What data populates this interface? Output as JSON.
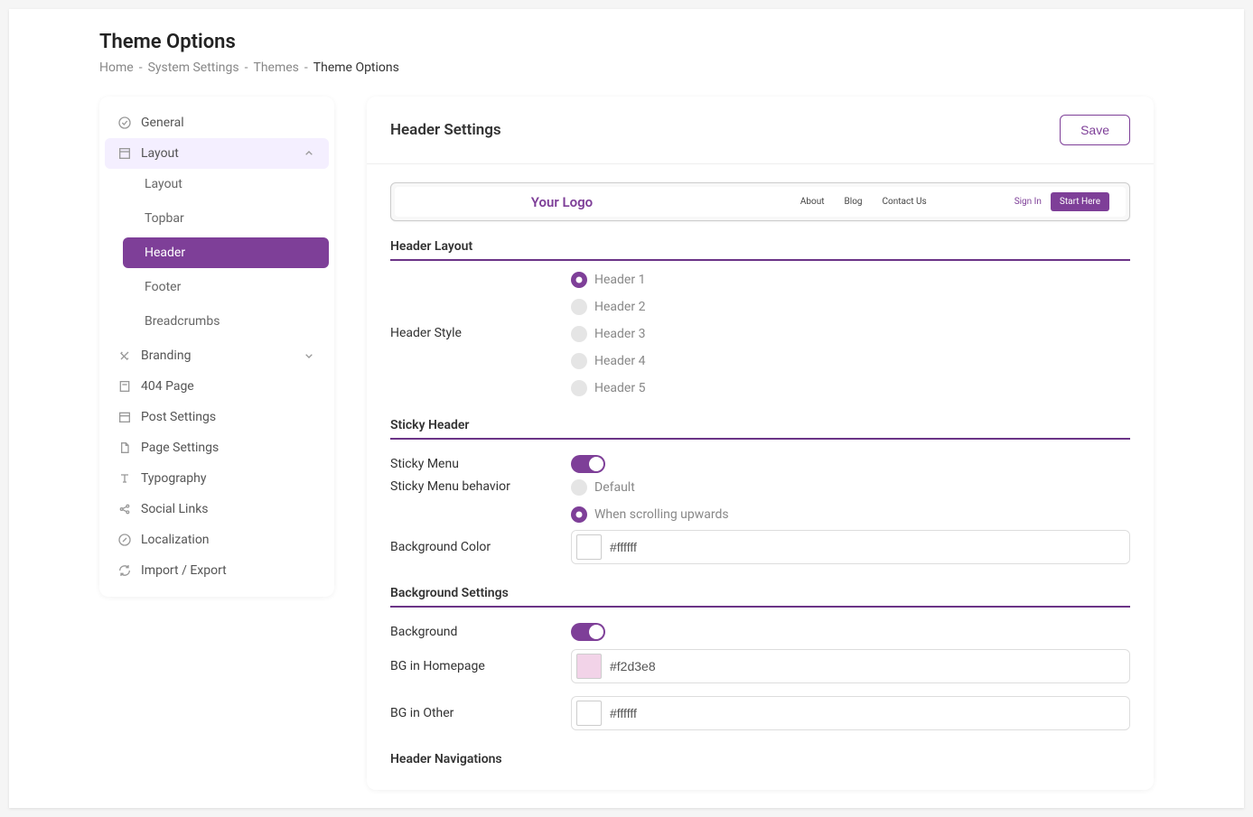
{
  "page": {
    "title": "Theme Options",
    "breadcrumb": [
      "Home",
      "System Settings",
      "Themes",
      "Theme Options"
    ]
  },
  "sidebar": {
    "general": "General",
    "layout": {
      "label": "Layout",
      "items": [
        "Layout",
        "Topbar",
        "Header",
        "Footer",
        "Breadcrumbs"
      ]
    },
    "branding": "Branding",
    "page_404": "404 Page",
    "post_settings": "Post Settings",
    "page_settings": "Page Settings",
    "typography": "Typography",
    "social_links": "Social Links",
    "localization": "Localization",
    "import_export": "Import / Export"
  },
  "main": {
    "title": "Header Settings",
    "save": "Save",
    "preview": {
      "logo": "Your Logo",
      "nav": [
        "About",
        "Blog",
        "Contact Us"
      ],
      "signin": "Sign In",
      "cta": "Start Here"
    },
    "sections": {
      "header_layout": {
        "title": "Header Layout",
        "label": "Header Style",
        "options": [
          "Header 1",
          "Header 2",
          "Header 3",
          "Header 4",
          "Header 5"
        ]
      },
      "sticky_header": {
        "title": "Sticky Header",
        "sticky_menu": "Sticky Menu",
        "behavior": {
          "label": "Sticky Menu behavior",
          "options": [
            "Default",
            "When scrolling upwards"
          ]
        },
        "bg_color": {
          "label": "Background Color",
          "value": "#ffffff"
        }
      },
      "background_settings": {
        "title": "Background Settings",
        "background": "Background",
        "bg_home": {
          "label": "BG in Homepage",
          "value": "#f2d3e8"
        },
        "bg_other": {
          "label": "BG in Other",
          "value": "#ffffff"
        }
      },
      "header_navigations": {
        "title": "Header Navigations"
      }
    }
  }
}
